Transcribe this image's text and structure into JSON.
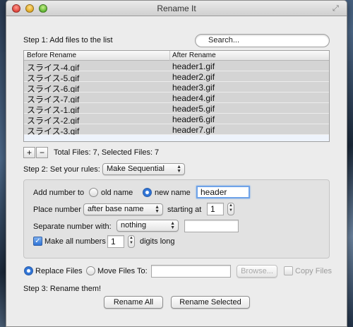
{
  "window": {
    "title": "Rename It"
  },
  "step1": {
    "label": "Step 1: Add files to the list",
    "search_placeholder": "Search..."
  },
  "table": {
    "columns": [
      "Before Rename",
      "After Rename"
    ],
    "rows": [
      [
        "スライス-4.gif",
        "header1.gif"
      ],
      [
        "スライス-5.gif",
        "header2.gif"
      ],
      [
        "スライス-6.gif",
        "header3.gif"
      ],
      [
        "スライス-7.gif",
        "header4.gif"
      ],
      [
        "スライス-1.gif",
        "header5.gif"
      ],
      [
        "スライス-2.gif",
        "header6.gif"
      ],
      [
        "スライス-3.gif",
        "header7.gif"
      ]
    ]
  },
  "list_controls": {
    "add": "+",
    "remove": "−",
    "summary": "Total Files: 7,  Selected Files: 7"
  },
  "step2": {
    "label": "Step 2: Set your rules:",
    "rule_value": "Make Sequential"
  },
  "rules": {
    "add_number_to_label": "Add number to",
    "old_name_label": "old name",
    "new_name_label": "new name",
    "new_name_value": "header",
    "selected_target": "new name",
    "place_number_label": "Place number",
    "place_number_value": "after base name",
    "starting_at_label": "starting at",
    "starting_at_value": "1",
    "separate_label": "Separate number with:",
    "separator_value": "nothing",
    "separator_custom_value": "",
    "make_all_label": "Make all numbers",
    "make_all_checked": true,
    "digits_value": "1",
    "digits_long_label": "digits long"
  },
  "output": {
    "replace_label": "Replace Files",
    "move_label": "Move Files To:",
    "selected": "Replace Files",
    "move_path_value": "",
    "browse_label": "Browse...",
    "copy_label": "Copy Files",
    "copy_checked": false
  },
  "step3": {
    "label": "Step 3: Rename them!",
    "rename_all": "Rename All",
    "rename_selected": "Rename Selected"
  },
  "colors": {
    "row_selected": "#d4d4d4",
    "accent": "#2f74d6",
    "window_bg": "#ececec"
  }
}
